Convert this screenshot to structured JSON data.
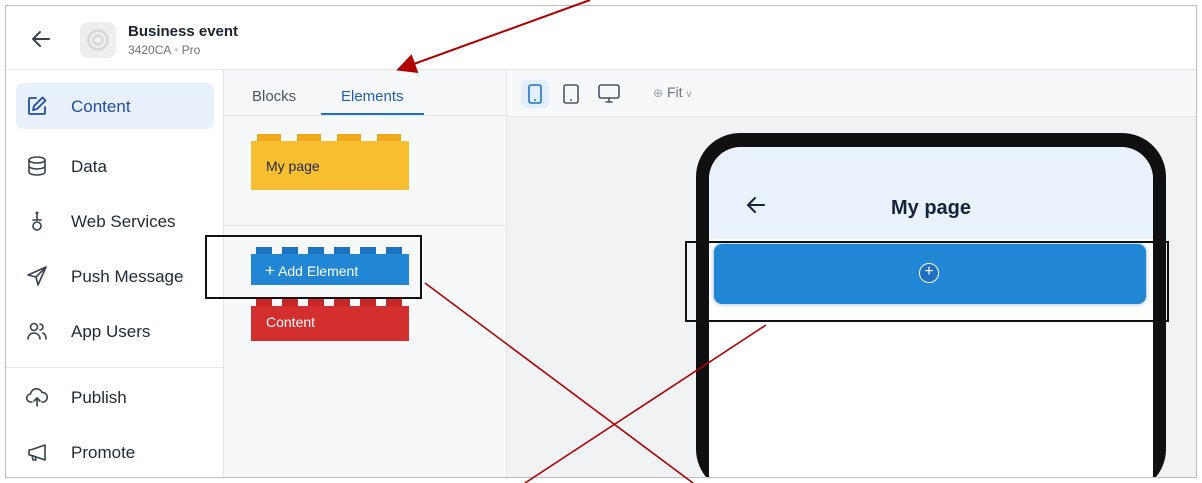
{
  "header": {
    "app_name": "Business event",
    "app_code": "3420CA",
    "plan": "Pro"
  },
  "sidebar": {
    "items": [
      {
        "label": "Content",
        "icon": "edit-icon",
        "active": true
      },
      {
        "label": "Data",
        "icon": "database-icon",
        "active": false
      },
      {
        "label": "Web Services",
        "icon": "webservice-icon",
        "active": false
      },
      {
        "label": "Push Message",
        "icon": "send-icon",
        "active": false
      },
      {
        "label": "App Users",
        "icon": "users-icon",
        "active": false
      },
      {
        "label": "Publish",
        "icon": "cloud-upload-icon",
        "active": false
      },
      {
        "label": "Promote",
        "icon": "megaphone-icon",
        "active": false
      }
    ]
  },
  "panel": {
    "tabs": [
      "Blocks",
      "Elements"
    ],
    "active_tab": "Elements",
    "page_brick_label": "My page",
    "add_element_label": "Add Element",
    "content_brick_label": "Content"
  },
  "toolbar": {
    "zoom_label": "Fit"
  },
  "preview": {
    "page_title": "My page"
  },
  "colors": {
    "accent": "#1e73c8",
    "yellow_brick": "#f7be2f",
    "blue_brick": "#2186d4",
    "red_brick": "#d32f2f",
    "annotation_arrow": "#b00000"
  }
}
